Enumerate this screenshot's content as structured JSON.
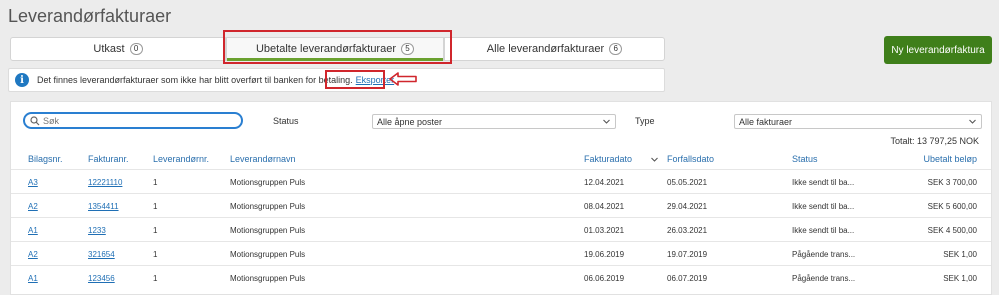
{
  "page": {
    "title": "Leverandørfakturaer"
  },
  "tabs": [
    {
      "label": "Utkast",
      "count": "0"
    },
    {
      "label": "Ubetalte leverandørfakturaer",
      "count": "5"
    },
    {
      "label": "Alle leverandørfakturaer",
      "count": "6"
    }
  ],
  "active_tab": "Ubetalte leverandørfakturaer",
  "new_button": {
    "label": "Ny leverandørfaktura"
  },
  "info": {
    "message": "Det finnes leverandørfakturaer som ikke har blitt overført til banken for betaling.",
    "link": "Eksporter"
  },
  "filters": {
    "search_placeholder": "Søk",
    "search_value": "",
    "status_label": "Status",
    "status_value": "Alle åpne poster",
    "type_label": "Type",
    "type_value": "Alle fakturaer"
  },
  "total": "Totalt: 13 797,25 NOK",
  "columns": {
    "bilagsnr": "Bilagsnr.",
    "fakturanr": "Fakturanr.",
    "leverandornr": "Leverandørnr.",
    "leverandornavn": "Leverandørnavn",
    "fakturadato": "Fakturadato",
    "forfallsdato": "Forfallsdato",
    "status": "Status",
    "belop": "Ubetalt beløp"
  },
  "rows": [
    {
      "bilagsnr": "A3",
      "fakturanr": "12221110",
      "leverandornr": "1",
      "leverandornavn": "Motionsgruppen Puls",
      "fakturadato": "12.04.2021",
      "forfallsdato": "05.05.2021",
      "status": "Ikke sendt til ba...",
      "belop": "SEK 3 700,00"
    },
    {
      "bilagsnr": "A2",
      "fakturanr": "1354411",
      "leverandornr": "1",
      "leverandornavn": "Motionsgruppen Puls",
      "fakturadato": "08.04.2021",
      "forfallsdato": "29.04.2021",
      "status": "Ikke sendt til ba...",
      "belop": "SEK 5 600,00"
    },
    {
      "bilagsnr": "A1",
      "fakturanr": "1233",
      "leverandornr": "1",
      "leverandornavn": "Motionsgruppen Puls",
      "fakturadato": "01.03.2021",
      "forfallsdato": "26.03.2021",
      "status": "Ikke sendt til ba...",
      "belop": "SEK 4 500,00"
    },
    {
      "bilagsnr": "A2",
      "fakturanr": "321654",
      "leverandornr": "1",
      "leverandornavn": "Motionsgruppen Puls",
      "fakturadato": "19.06.2019",
      "forfallsdato": "19.07.2019",
      "status": "Pågående trans...",
      "belop": "SEK 1,00"
    },
    {
      "bilagsnr": "A1",
      "fakturanr": "123456",
      "leverandornr": "1",
      "leverandornavn": "Motionsgruppen Puls",
      "fakturadato": "06.06.2019",
      "forfallsdato": "06.07.2019",
      "status": "Pågående trans...",
      "belop": "SEK 1,00"
    }
  ],
  "colors": {
    "primary_button": "#3f7f1a",
    "link": "#1f6fb5",
    "highlight": "#d0262c",
    "active_tab_underline": "#6aa12f"
  }
}
